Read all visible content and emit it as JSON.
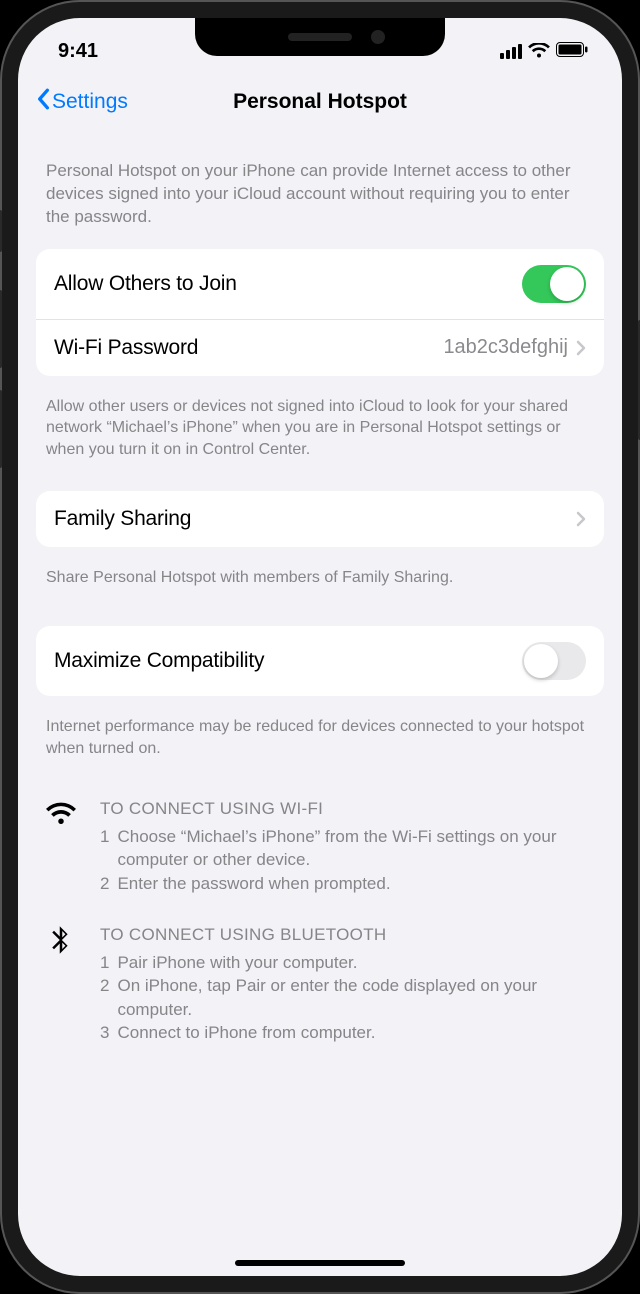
{
  "status": {
    "time": "9:41"
  },
  "nav": {
    "back": "Settings",
    "title": "Personal Hotspot"
  },
  "intro": "Personal Hotspot on your iPhone can provide Internet access to other devices signed into your iCloud account without requiring you to enter the password.",
  "allow": {
    "label": "Allow Others to Join",
    "on": true
  },
  "wifi": {
    "label": "Wi-Fi Password",
    "value": "1ab2c3defghij"
  },
  "allowFooter": "Allow other users or devices not signed into iCloud to look for your shared network “Michael’s iPhone” when you are in Personal Hotspot settings or when you turn it on in Control Center.",
  "family": {
    "label": "Family Sharing",
    "footer": "Share Personal Hotspot with members of Family Sharing."
  },
  "maxcompat": {
    "label": "Maximize Compatibility",
    "on": false,
    "footer": "Internet performance may be reduced for devices connected to your hotspot when turned on."
  },
  "connect": {
    "wifi": {
      "title": "TO CONNECT USING WI-FI",
      "steps": [
        "Choose “Michael’s iPhone” from the Wi-Fi settings on your computer or other device.",
        "Enter the password when prompted."
      ]
    },
    "bt": {
      "title": "TO CONNECT USING BLUETOOTH",
      "steps": [
        "Pair iPhone with your computer.",
        "On iPhone, tap Pair or enter the code displayed on your computer.",
        "Connect to iPhone from computer."
      ]
    }
  }
}
